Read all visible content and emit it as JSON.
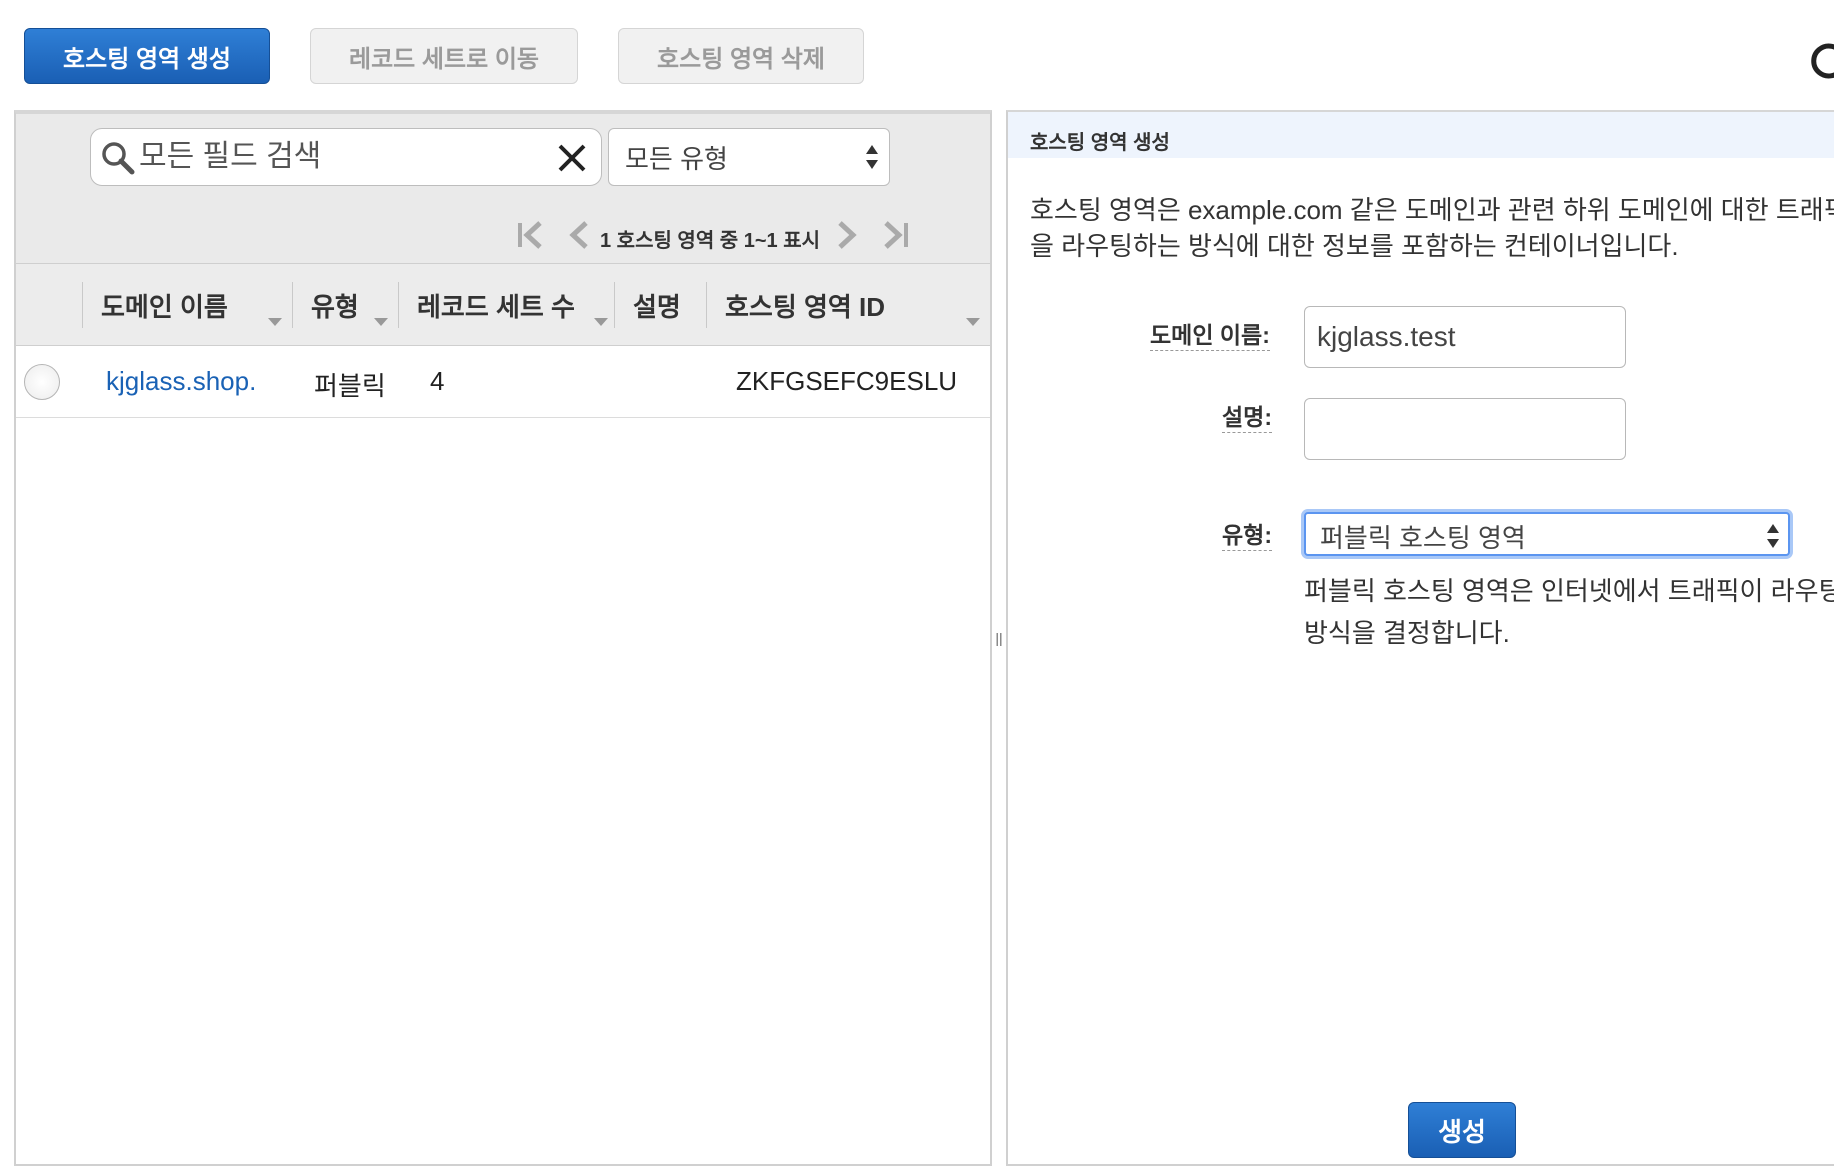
{
  "toolbar": {
    "create_label": "호스팅 영역 생성",
    "move_label": "레코드 세트로 이동",
    "delete_label": "호스팅 영역 삭제"
  },
  "filter": {
    "search_placeholder": "모든 필드 검색",
    "type_selected": "모든 유형"
  },
  "pager": {
    "text": "1 호스팅 영역 중 1~1 표시"
  },
  "table": {
    "columns": [
      "도메인 이름",
      "유형",
      "레코드 세트 수",
      "설명",
      "호스팅 영역 ID"
    ],
    "rows": [
      {
        "domain": "kjglass.shop.",
        "type": "퍼블릭",
        "record_count": "4",
        "description": "",
        "zone_id": "ZKFGSEFC9ESLU"
      }
    ]
  },
  "form": {
    "header": "호스팅 영역 생성",
    "description_line1": "호스팅 영역은 example.com 같은 도메인과 관련 하위 도메인에 대한 트래픽",
    "description_line2": "을 라우팅하는 방식에 대한 정보를 포함하는 컨테이너입니다.",
    "domain_label": "도메인 이름:",
    "domain_value": "kjglass.test",
    "comment_label": "설명:",
    "comment_value": "",
    "type_label": "유형:",
    "type_selected": "퍼블릭 호스팅 영역",
    "type_help_line1": "퍼블릭 호스팅 영역은 인터넷에서 트래픽이 라우팅되는",
    "type_help_line2": "방식을 결정합니다.",
    "submit_label": "생성"
  },
  "colors": {
    "primary": "#1a5fb4",
    "link": "#1a62b5",
    "focus": "#5b95f0"
  }
}
